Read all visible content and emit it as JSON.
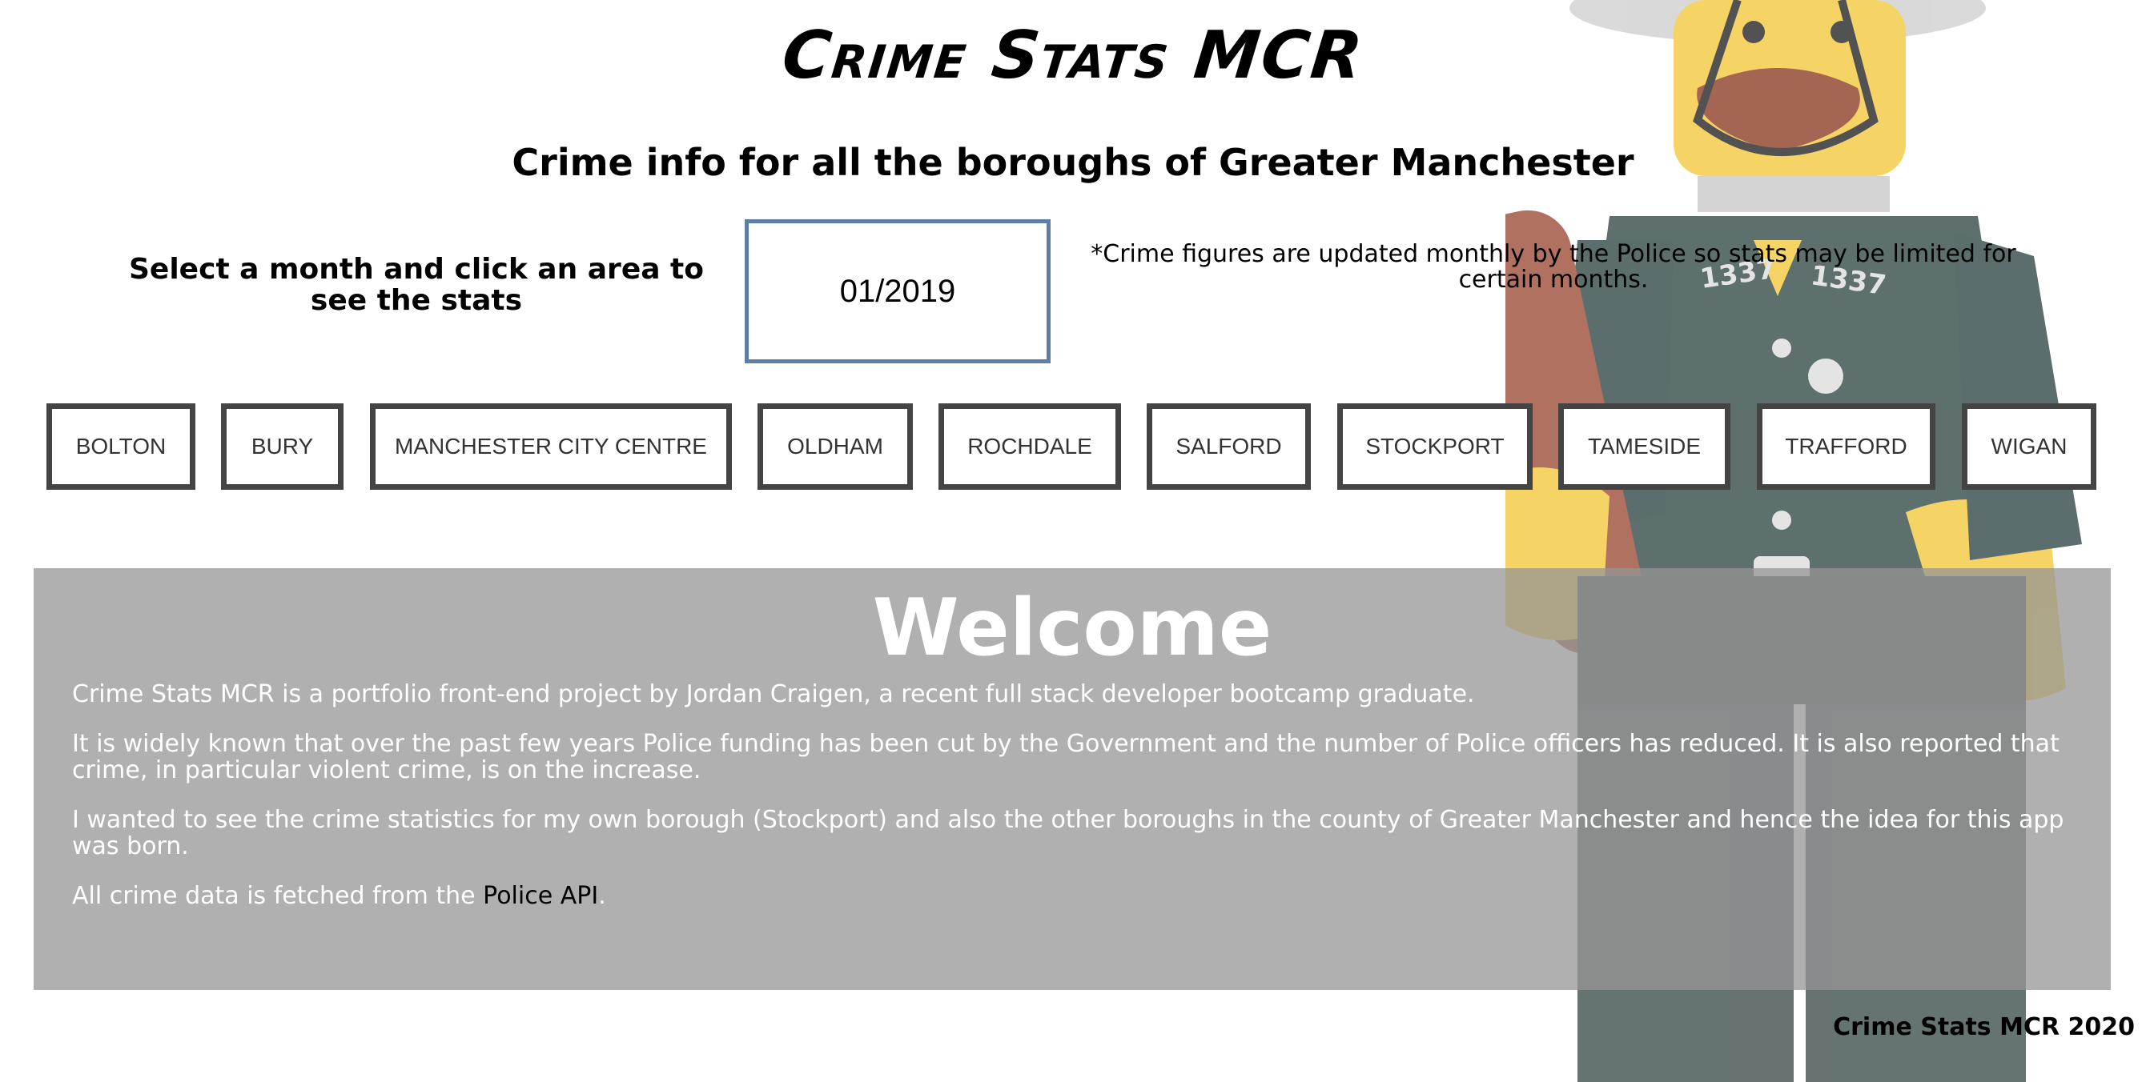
{
  "site": {
    "title": "Crime Stats MCR",
    "subtitle": "Crime info for all the boroughs of Greater Manchester"
  },
  "controls": {
    "instructions": "Select a month and click an area to see the stats",
    "month_value": "01/2019",
    "note": "*Crime figures are updated monthly by the Police so stats may be limited for certain months."
  },
  "boroughs": [
    "BOLTON",
    "BURY",
    "MANCHESTER CITY CENTRE",
    "OLDHAM",
    "ROCHDALE",
    "SALFORD",
    "STOCKPORT",
    "TAMESIDE",
    "TRAFFORD",
    "WIGAN"
  ],
  "welcome": {
    "title": "Welcome",
    "p1": "Crime Stats MCR is a portfolio front-end project by Jordan Craigen, a recent full stack developer bootcamp graduate.",
    "p2": "It is widely known that over the past few years Police funding has been cut by the Government and the number of Police officers has reduced. It is also reported that crime, in particular violent crime, is on the increase.",
    "p3": "I wanted to see the crime statistics for my own borough (Stockport) and also the other boroughs in the county of Greater Manchester and hence the idea for this app was born.",
    "p4_prefix": "All crime data is fetched from the ",
    "p4_link": "Police API",
    "p4_suffix": "."
  },
  "background": {
    "badge_left": "1337",
    "badge_right": "1337"
  },
  "footer": "Crime Stats MCR 2020",
  "colors": {
    "month_border": "#5b7fa6",
    "button_border": "#444444",
    "panel_bg": "#969696"
  }
}
